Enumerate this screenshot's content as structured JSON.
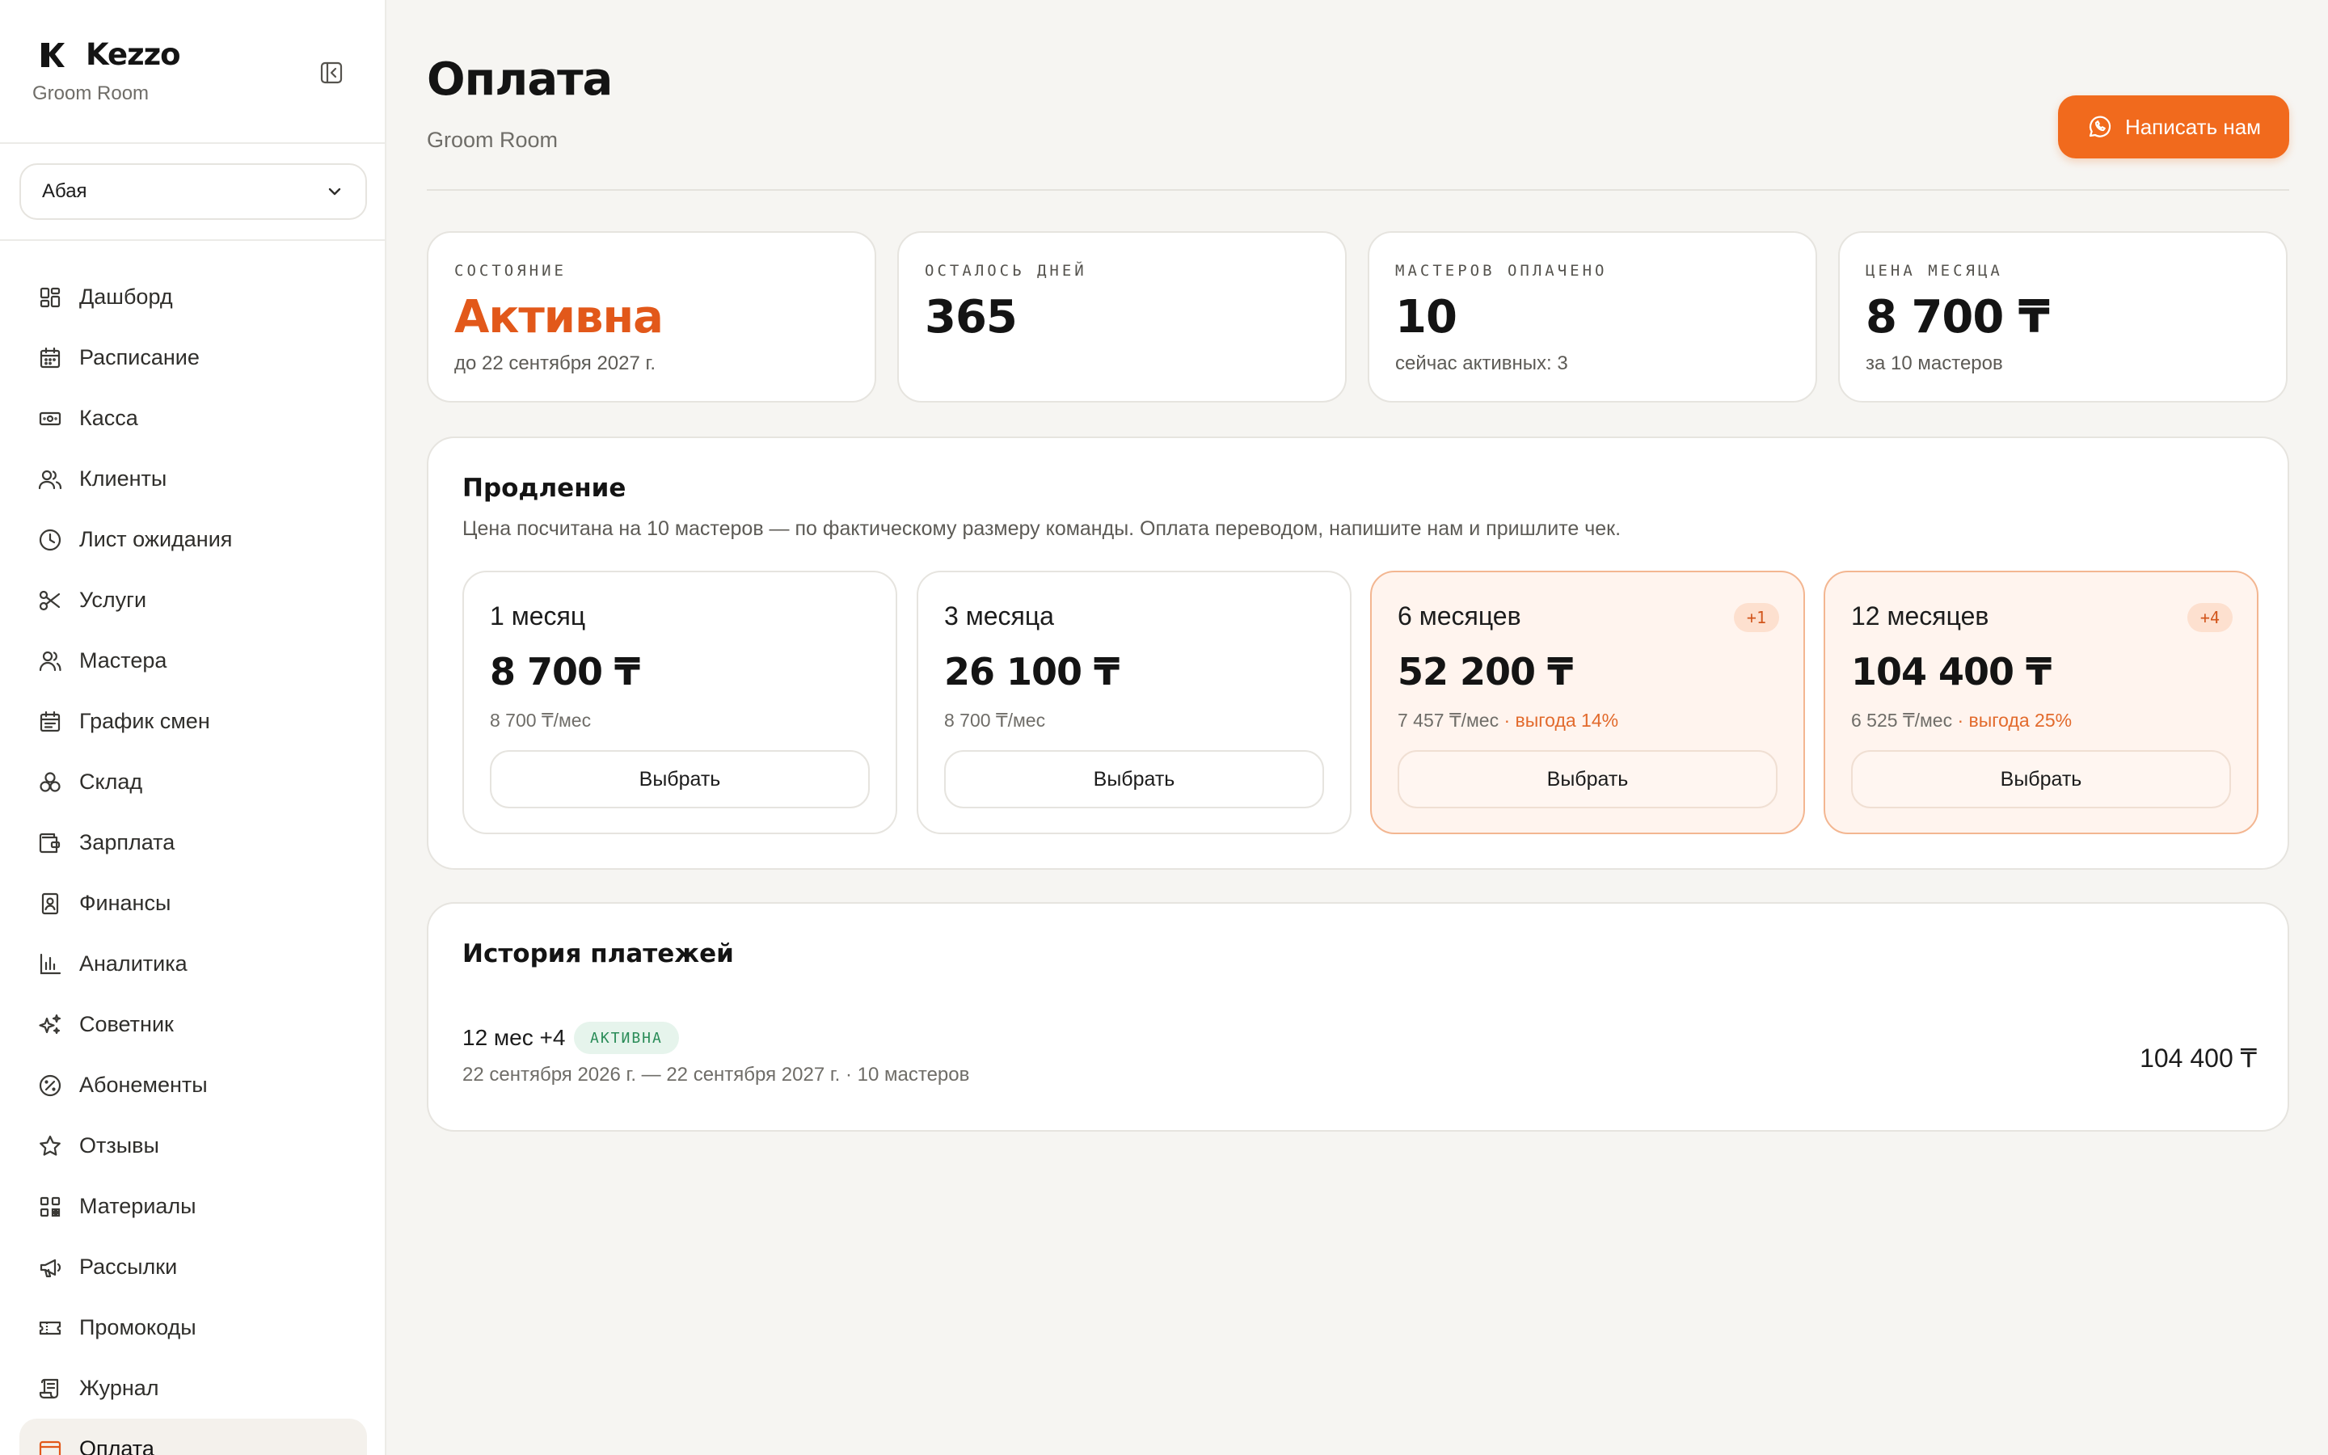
{
  "sidebar": {
    "brand": "Kezzo",
    "brand_sub": "Groom Room",
    "branch": "Абая",
    "items": [
      {
        "label": "Дашборд",
        "icon": "dashboard-icon"
      },
      {
        "label": "Расписание",
        "icon": "calendar-icon"
      },
      {
        "label": "Касса",
        "icon": "cash-icon"
      },
      {
        "label": "Клиенты",
        "icon": "users-icon"
      },
      {
        "label": "Лист ожидания",
        "icon": "clock-icon"
      },
      {
        "label": "Услуги",
        "icon": "scissors-icon"
      },
      {
        "label": "Мастера",
        "icon": "user-group-icon"
      },
      {
        "label": "График смен",
        "icon": "shift-calendar-icon"
      },
      {
        "label": "Склад",
        "icon": "boxes-icon"
      },
      {
        "label": "Зарплата",
        "icon": "wallet-icon"
      },
      {
        "label": "Финансы",
        "icon": "ledger-icon"
      },
      {
        "label": "Аналитика",
        "icon": "bar-chart-icon"
      },
      {
        "label": "Советник",
        "icon": "sparkles-icon"
      },
      {
        "label": "Абонементы",
        "icon": "percent-badge-icon"
      },
      {
        "label": "Отзывы",
        "icon": "star-icon"
      },
      {
        "label": "Материалы",
        "icon": "qr-code-icon"
      },
      {
        "label": "Рассылки",
        "icon": "megaphone-icon"
      },
      {
        "label": "Промокоды",
        "icon": "ticket-icon"
      },
      {
        "label": "Журнал",
        "icon": "scroll-icon"
      },
      {
        "label": "Оплата",
        "icon": "credit-card-icon",
        "active": true
      }
    ]
  },
  "header": {
    "title": "Оплата",
    "subtitle": "Groom Room",
    "cta_label": "Написать нам",
    "cta_icon": "whatsapp-icon"
  },
  "stats": [
    {
      "caption": "Состояние",
      "value": "Активна",
      "note": "до 22 сентября 2027 г."
    },
    {
      "caption": "Осталось дней",
      "value": "365",
      "note": ""
    },
    {
      "caption": "Мастеров оплачено",
      "value": "10",
      "note": "сейчас активных: 3"
    },
    {
      "caption": "Цена месяца",
      "value": "8 700 ₸",
      "note": "за 10 мастеров"
    }
  ],
  "renewal": {
    "title": "Продление",
    "description": "Цена посчитана на 10 мастеров — по фактическому размеру команды. Оплата переводом, напишите нам и пришлите чек.",
    "plans": [
      {
        "name": "1 месяц",
        "badge": "",
        "price": "8 700 ₸",
        "per_month": "8 700 ₸/мес",
        "savings": "",
        "button": "Выбрать"
      },
      {
        "name": "3 месяца",
        "badge": "",
        "price": "26 100 ₸",
        "per_month": "8 700 ₸/мес",
        "savings": "",
        "button": "Выбрать"
      },
      {
        "name": "6 месяцев",
        "badge": "+1",
        "price": "52 200 ₸",
        "per_month": "7 457 ₸/мес",
        "savings": " · выгода 14%",
        "button": "Выбрать"
      },
      {
        "name": "12 месяцев",
        "badge": "+4",
        "price": "104 400 ₸",
        "per_month": "6 525 ₸/мес",
        "savings": " · выгода 25%",
        "button": "Выбрать"
      }
    ]
  },
  "history": {
    "title": "История платежей",
    "rows": [
      {
        "term": "12 мес +4",
        "status": "Активна",
        "range": "22 сентября 2026 г. — 22 сентября 2027 г. · 10 мастеров",
        "amount": "104 400 ₸"
      }
    ]
  },
  "colors": {
    "accent": "#f16a1d",
    "active_value": "#e2581a",
    "status_green": "#2a8c58",
    "background": "#f6f5f2"
  }
}
